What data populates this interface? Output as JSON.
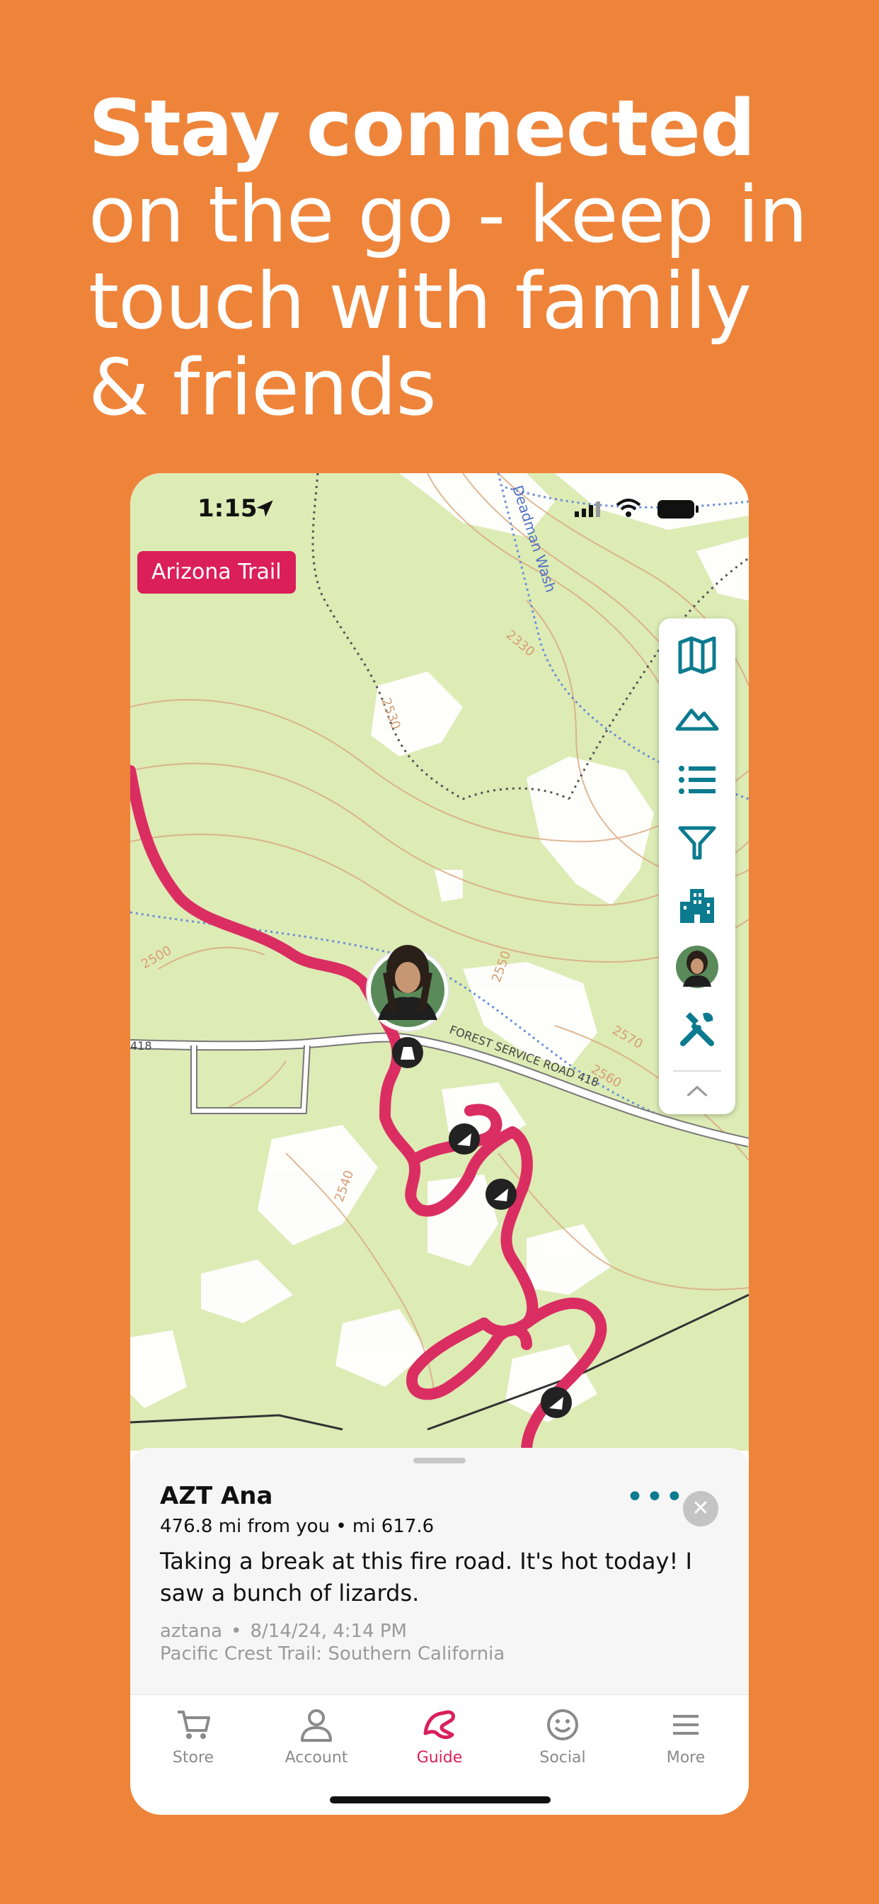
{
  "headline": {
    "bold": "Stay connected",
    "rest": " on the go - keep in touch with family & friends"
  },
  "status_bar": {
    "time": "1:15"
  },
  "map": {
    "trail_badge": "Arizona Trail",
    "labels": {
      "wash": "Deadman Wash",
      "road": "FOREST SERVICE ROAD 418",
      "road_number": "418",
      "contours": [
        "2330",
        "2530",
        "2500",
        "2550",
        "2570",
        "2540",
        "2560"
      ]
    }
  },
  "toolbar": {
    "items": [
      "map-layers-icon",
      "terrain-icon",
      "list-icon",
      "filter-icon",
      "towns-icon",
      "friend-avatar",
      "tools-icon",
      "collapse-icon"
    ]
  },
  "sheet": {
    "name": "AZT Ana",
    "distance": "476.8 mi from you • mi 617.6",
    "message": "Taking a break at this fire road. It's hot today! I saw a bunch of lizards.",
    "username": "aztana",
    "separator": "•",
    "timestamp": "8/14/24, 4:14 PM",
    "trail": "Pacific Crest Trail: Southern California",
    "more_label": "•••",
    "close_label": "✕"
  },
  "tabs": [
    {
      "label": "Store",
      "icon": "cart-icon"
    },
    {
      "label": "Account",
      "icon": "person-icon"
    },
    {
      "label": "Guide",
      "icon": "guide-icon",
      "active": true
    },
    {
      "label": "Social",
      "icon": "smiley-icon"
    },
    {
      "label": "More",
      "icon": "menu-icon"
    }
  ],
  "colors": {
    "background": "#EE843A",
    "accent": "#DA1F5A",
    "teal": "#0C7B8F",
    "map_green": "#DDEBB5"
  }
}
